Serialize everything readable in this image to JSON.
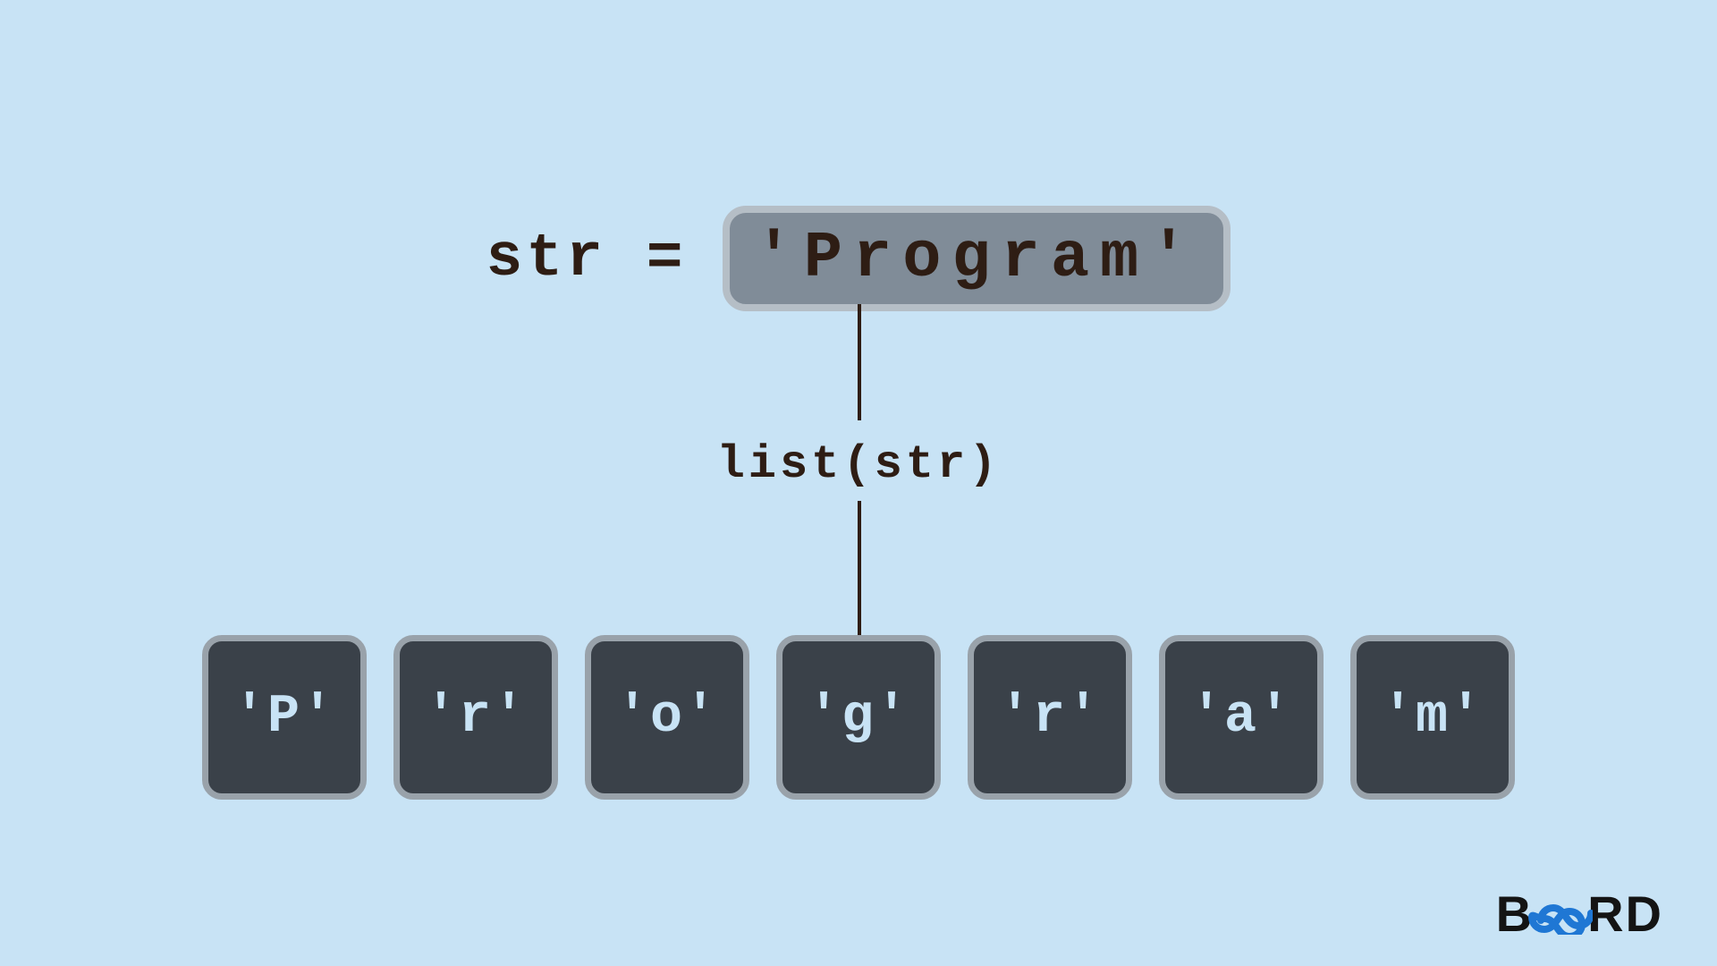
{
  "top": {
    "decl": "str =",
    "value": "'Program'"
  },
  "func": "list(str)",
  "cells": [
    "'P'",
    "'r'",
    "'o'",
    "'g'",
    "'r'",
    "'a'",
    "'m'"
  ],
  "brand": {
    "b": "B",
    "rd": "RD"
  }
}
